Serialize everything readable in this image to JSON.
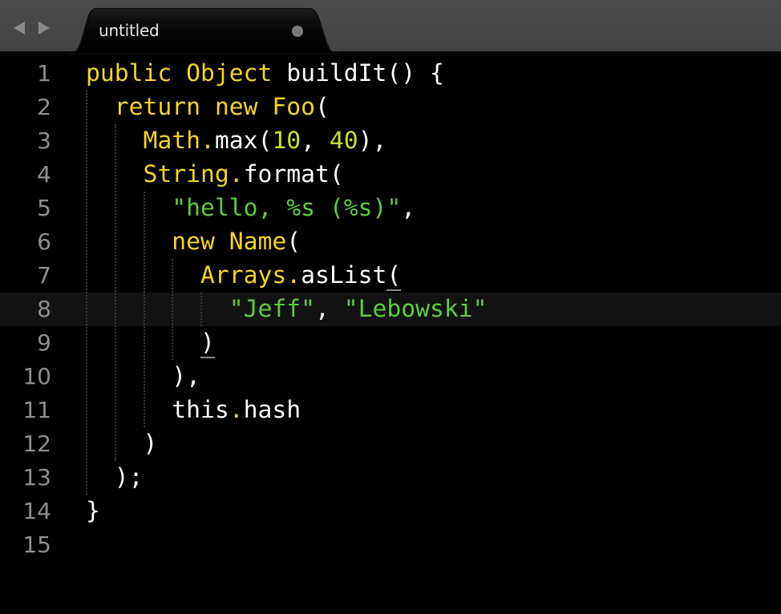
{
  "app": {
    "tab": {
      "title": "untitled",
      "dirty_indicator": "unsaved-dot-icon"
    },
    "nav": {
      "back_icon": "arrow-left-icon",
      "forward_icon": "arrow-right-icon"
    }
  },
  "colors": {
    "background": "#000000",
    "tabbar": "#474747",
    "current_line": "#121212",
    "gutter_text": "#8e8e8e",
    "keyword": "#f5d22a",
    "string": "#5ccd3e",
    "number": "#c6e12b",
    "plain": "#ffffff"
  },
  "editor": {
    "current_line": 8,
    "lines": [
      {
        "num": "1",
        "tokens": [
          [
            "kw",
            "public Object"
          ],
          [
            "plain",
            " buildIt() {"
          ]
        ]
      },
      {
        "num": "2",
        "tokens": [
          [
            "plain",
            "  "
          ],
          [
            "kw",
            "return new Foo"
          ],
          [
            "plain",
            "("
          ]
        ]
      },
      {
        "num": "3",
        "tokens": [
          [
            "plain",
            "    "
          ],
          [
            "kw",
            "Math."
          ],
          [
            "plain",
            "max("
          ],
          [
            "num",
            "10"
          ],
          [
            "plain",
            ", "
          ],
          [
            "num",
            "40"
          ],
          [
            "plain",
            "),"
          ]
        ]
      },
      {
        "num": "4",
        "tokens": [
          [
            "plain",
            "    "
          ],
          [
            "kw",
            "String."
          ],
          [
            "plain",
            "format("
          ]
        ]
      },
      {
        "num": "5",
        "tokens": [
          [
            "plain",
            "      "
          ],
          [
            "str",
            "\"hello, %s (%s)\""
          ],
          [
            "plain",
            ","
          ]
        ]
      },
      {
        "num": "6",
        "tokens": [
          [
            "plain",
            "      "
          ],
          [
            "kw",
            "new Name"
          ],
          [
            "plain",
            "("
          ]
        ]
      },
      {
        "num": "7",
        "tokens": [
          [
            "plain",
            "        "
          ],
          [
            "kw",
            "Arrays."
          ],
          [
            "plain",
            "asList"
          ],
          [
            "match",
            "("
          ]
        ]
      },
      {
        "num": "8",
        "tokens": [
          [
            "plain",
            "          "
          ],
          [
            "str",
            "\"Jeff\""
          ],
          [
            "plain",
            ", "
          ],
          [
            "str",
            "\"Lebowski\""
          ]
        ]
      },
      {
        "num": "9",
        "tokens": [
          [
            "plain",
            "        "
          ],
          [
            "match",
            ")"
          ]
        ]
      },
      {
        "num": "10",
        "tokens": [
          [
            "plain",
            "      ),"
          ]
        ]
      },
      {
        "num": "11",
        "tokens": [
          [
            "plain",
            "      this"
          ],
          [
            "kw",
            "."
          ],
          [
            "plain",
            "hash"
          ]
        ]
      },
      {
        "num": "12",
        "tokens": [
          [
            "plain",
            "    )"
          ]
        ]
      },
      {
        "num": "13",
        "tokens": [
          [
            "plain",
            "  );"
          ]
        ]
      },
      {
        "num": "14",
        "tokens": [
          [
            "plain",
            "}"
          ]
        ]
      },
      {
        "num": "15",
        "tokens": []
      }
    ]
  }
}
